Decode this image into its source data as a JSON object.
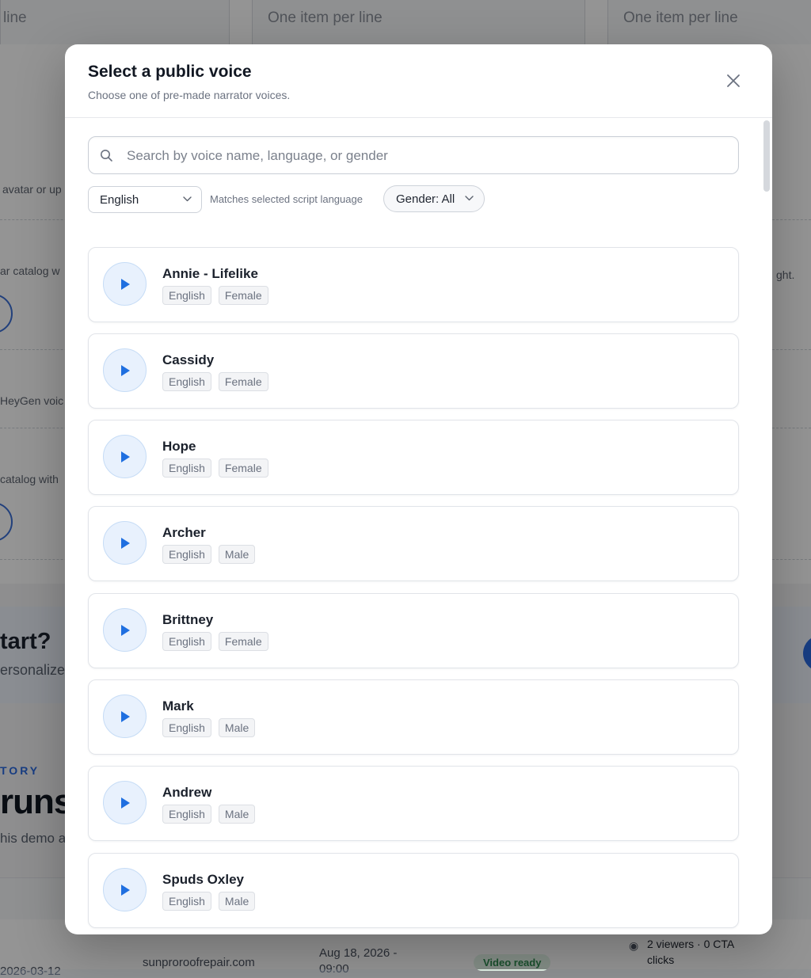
{
  "background": {
    "columns": [
      {
        "text": "line"
      },
      {
        "text": "One item per line"
      },
      {
        "text": "One item per line"
      }
    ],
    "left_snippets": [
      "avatar or up",
      "ar catalog w",
      "HeyGen voic",
      "catalog with"
    ],
    "right_snippet": "ght.",
    "cta": {
      "title": "tart?",
      "subtitle": "ersonalize"
    },
    "history": {
      "kicker": "TORY",
      "title": "runs",
      "subtitle": "his demo a"
    },
    "table_row": {
      "date": "2026-03-12",
      "domain": "sunproroofrepair.com",
      "scheduled": "Aug 18, 2026 -",
      "scheduled_time": "09:00",
      "status": "Video ready",
      "viewers": "2 viewers · 0 CTA",
      "viewers_line2": "clicks"
    }
  },
  "modal": {
    "title": "Select a public voice",
    "subtitle": "Choose one of pre-made narrator voices.",
    "close_icon": "close-icon",
    "search": {
      "placeholder": "Search by voice name, language, or gender",
      "value": ""
    },
    "language_filter": {
      "selected": "English"
    },
    "filter_hint": "Matches selected script language",
    "gender_filter": {
      "selected": "Gender: All"
    },
    "voices": [
      {
        "name": "Annie - Lifelike",
        "language": "English",
        "gender": "Female"
      },
      {
        "name": "Cassidy",
        "language": "English",
        "gender": "Female"
      },
      {
        "name": "Hope",
        "language": "English",
        "gender": "Female"
      },
      {
        "name": "Archer",
        "language": "English",
        "gender": "Male"
      },
      {
        "name": "Brittney",
        "language": "English",
        "gender": "Female"
      },
      {
        "name": "Mark",
        "language": "English",
        "gender": "Male"
      },
      {
        "name": "Andrew",
        "language": "English",
        "gender": "Male"
      },
      {
        "name": "Spuds Oxley",
        "language": "English",
        "gender": "Male"
      }
    ]
  },
  "colors": {
    "accent": "#2a6ae0",
    "play_icon": "#1f6fe0",
    "play_bg": "#e8f1fd"
  }
}
